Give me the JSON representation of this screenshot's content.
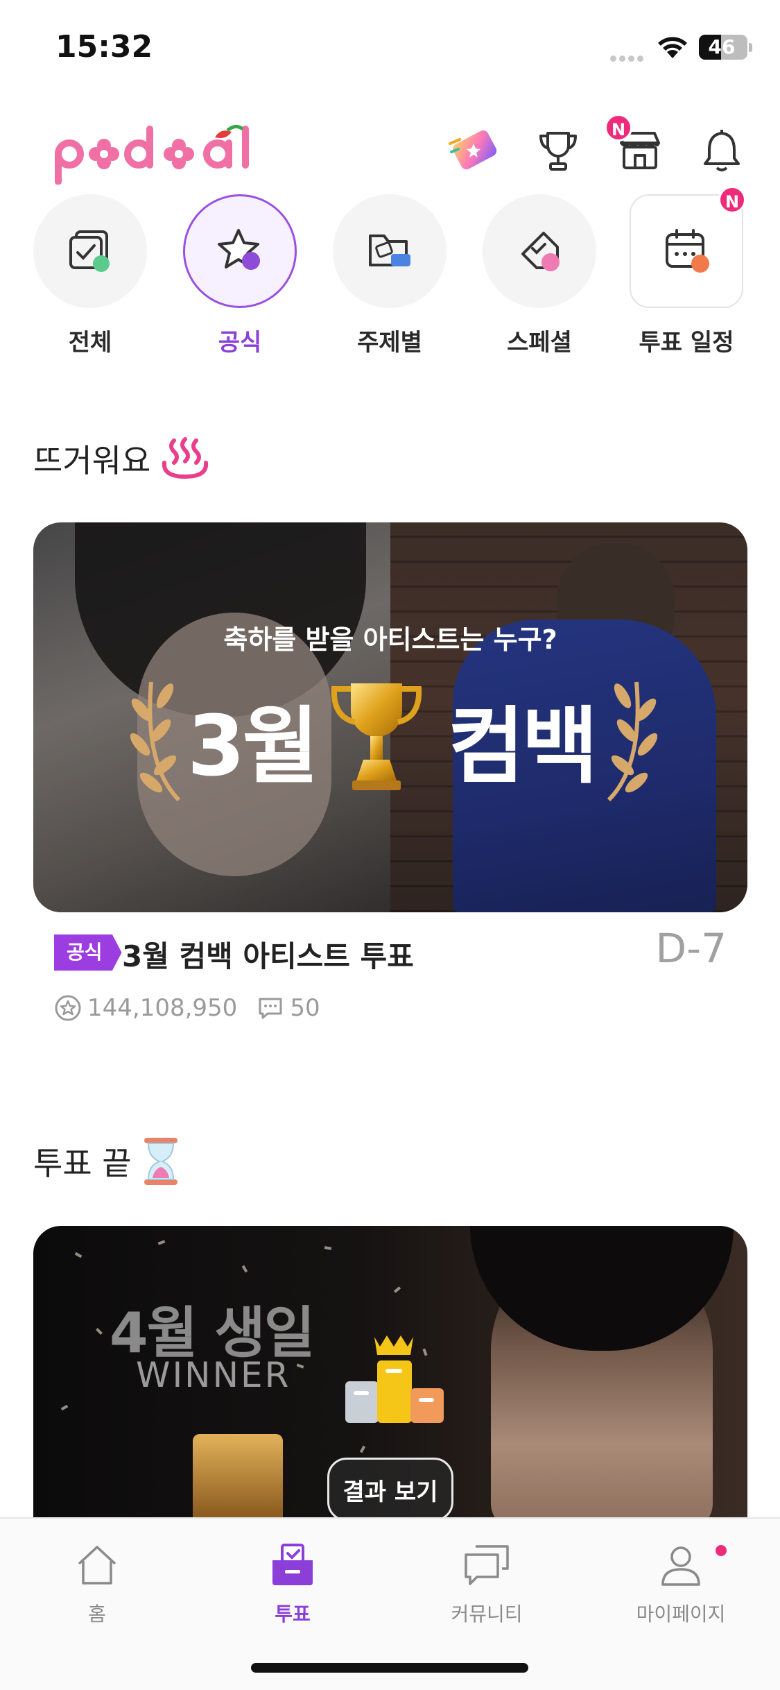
{
  "status_bar": {
    "time": "15:32",
    "battery": "46",
    "battery_level": 0.46
  },
  "header": {
    "logo_text": "podoal",
    "notification_badge": "N"
  },
  "categories": [
    {
      "label": "전체",
      "icon": "all-cards-icon",
      "active": false
    },
    {
      "label": "공식",
      "icon": "official-star-icon",
      "active": true
    },
    {
      "label": "주제별",
      "icon": "topic-folder-icon",
      "active": false
    },
    {
      "label": "스페셜",
      "icon": "special-tag-icon",
      "active": false
    },
    {
      "label": "투표 일정",
      "icon": "calendar-icon",
      "active": false,
      "badge": "N"
    }
  ],
  "hot_section": {
    "title": "뜨거워요",
    "banner": {
      "subtitle": "축하를 받을 아티스트는 누구?",
      "left_text": "3월",
      "right_text": "컴백"
    },
    "tag": "공식",
    "vote_title": "3월 컴백 아티스트 투표",
    "dday": "D-7",
    "star_count": "144,108,950",
    "comment_count": "50"
  },
  "ended_section": {
    "title": "투표 끝",
    "banner": {
      "title": "4월 생일",
      "subtitle": "WINNER"
    },
    "result_button": "결과 보기"
  },
  "tabbar": {
    "items": [
      {
        "label": "홈",
        "icon": "home-icon",
        "active": false
      },
      {
        "label": "투표",
        "icon": "vote-box-icon",
        "active": true
      },
      {
        "label": "커뮤니티",
        "icon": "chat-bubbles-icon",
        "active": false
      },
      {
        "label": "마이페이지",
        "icon": "person-icon",
        "active": false
      }
    ]
  },
  "colors": {
    "accent": "#8b3fd8",
    "badge": "#ee2b7b",
    "logo": "#f06fa4"
  }
}
